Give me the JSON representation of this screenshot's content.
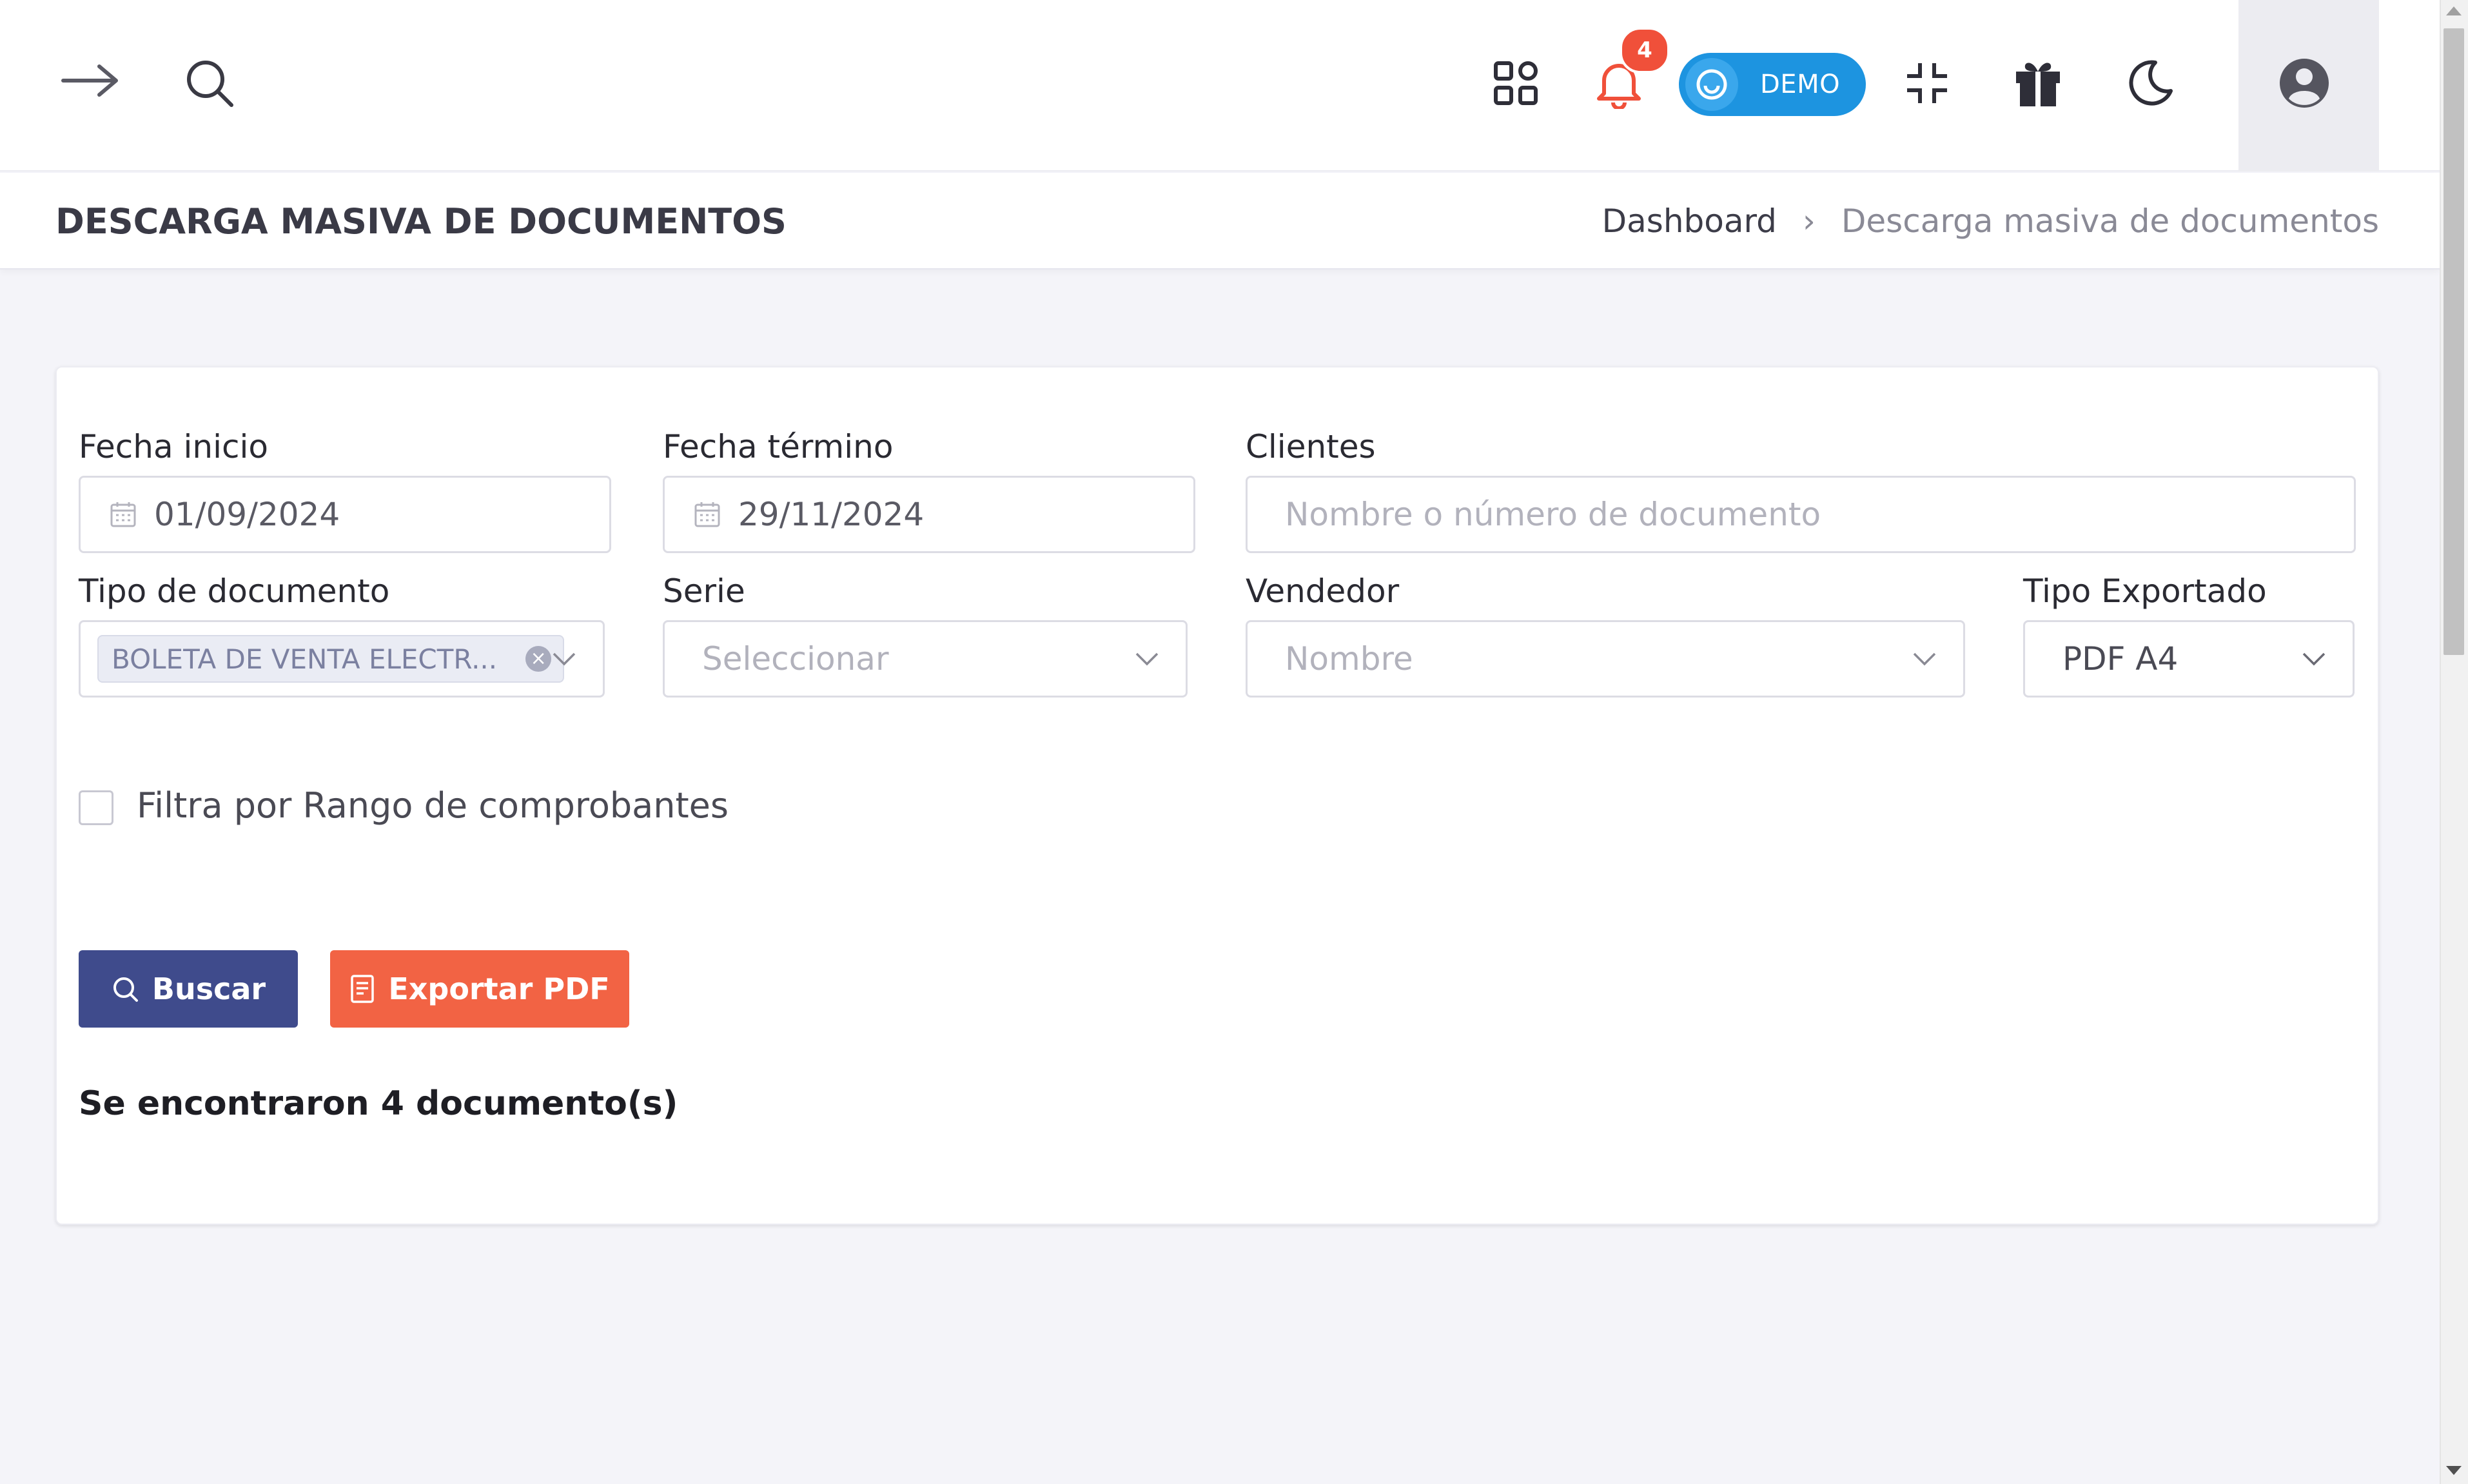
{
  "topbar": {
    "notification_count": "4",
    "demo_label": "DEMO"
  },
  "page": {
    "title": "DESCARGA MASIVA DE DOCUMENTOS",
    "breadcrumb": {
      "home": "Dashboard",
      "separator": "›",
      "current": "Descarga masiva de documentos"
    }
  },
  "form": {
    "fecha_inicio": {
      "label": "Fecha inicio",
      "value": "01/09/2024"
    },
    "fecha_termino": {
      "label": "Fecha término",
      "value": "29/11/2024"
    },
    "clientes": {
      "label": "Clientes",
      "placeholder": "Nombre o número de documento"
    },
    "tipo_documento": {
      "label": "Tipo de documento",
      "selected_chip": "BOLETA DE VENTA ELECTR...",
      "chip_remove": "×"
    },
    "serie": {
      "label": "Serie",
      "placeholder": "Seleccionar"
    },
    "vendedor": {
      "label": "Vendedor",
      "placeholder": "Nombre"
    },
    "tipo_exportado": {
      "label": "Tipo Exportado",
      "value": "PDF A4"
    },
    "rango_checkbox": {
      "label": "Filtra por Rango de comprobantes",
      "checked": false
    }
  },
  "actions": {
    "buscar": "Buscar",
    "exportar": "Exportar PDF"
  },
  "result_text": "Se encontraron 4 documento(s)",
  "colors": {
    "primary_button": "#3f4b8c",
    "export_button": "#f26344",
    "demo_pill": "#1d94e0",
    "notification_badge": "#f0503a"
  },
  "icons": {
    "menu_toggle": "arrow-right-icon",
    "search": "search-icon",
    "apps": "apps-grid-icon",
    "notifications": "bell-icon",
    "fullscreen": "compress-icon",
    "gift": "gift-icon",
    "dark_mode": "moon-icon",
    "user": "user-circle-icon"
  }
}
